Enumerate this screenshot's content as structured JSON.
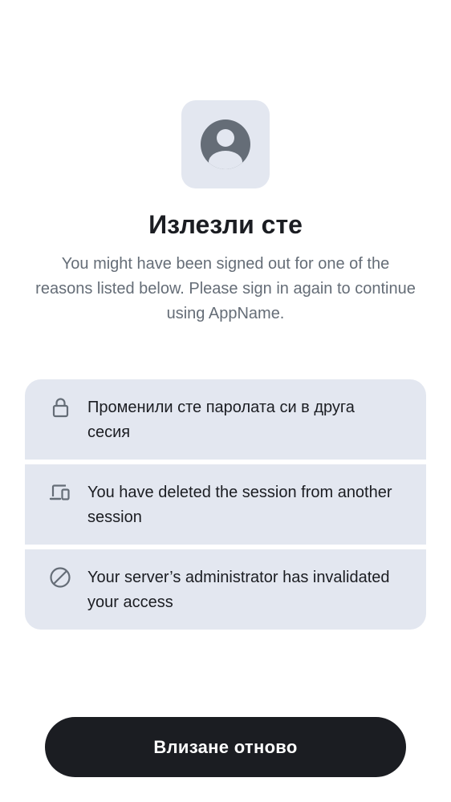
{
  "header": {
    "icon": "user-avatar-icon",
    "title": "Излезли сте",
    "subtitle": "You might have been signed out for one of the reasons listed below. Please sign in again to continue using AppName."
  },
  "reasons": [
    {
      "icon": "lock-icon",
      "text": "Променили сте паролата си в друга сесия"
    },
    {
      "icon": "devices-icon",
      "text": "You have deleted the session from another session"
    },
    {
      "icon": "block-icon",
      "text": "Your server’s administrator has invalidated your access"
    }
  ],
  "actions": {
    "sign_in_again_label": "Влизане отново"
  },
  "colors": {
    "card_background": "#e3e7f0",
    "icon": "#656d77",
    "text_primary": "#1b1d22",
    "text_secondary": "#656d77",
    "button_background": "#1b1d22",
    "button_text": "#ffffff"
  }
}
